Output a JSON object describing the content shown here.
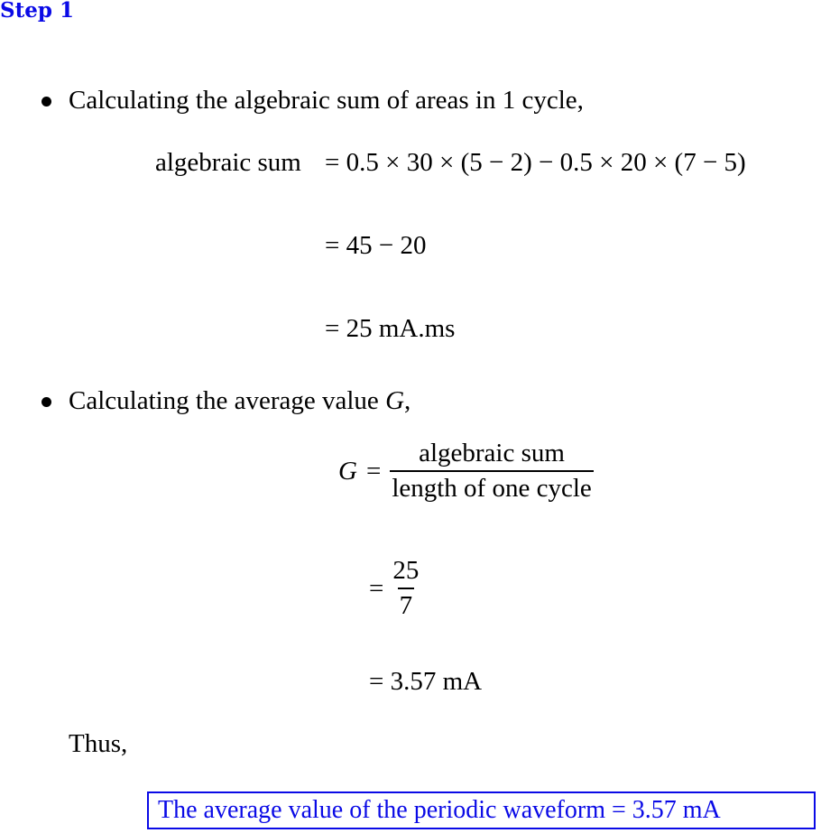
{
  "step": {
    "title": "Step 1"
  },
  "bullets": [
    {
      "text": "Calculating the algebraic sum of areas in 1 cycle,"
    },
    {
      "text_prefix": "Calculating the average value ",
      "variable": "G",
      "text_suffix": ","
    }
  ],
  "sum_equations": {
    "lhs": "algebraic sum",
    "line1": "= 0.5 × 30 × (5 − 2) − 0.5 × 20 × (7 − 5)",
    "line2": "= 45 − 20",
    "line3": "= 25 mA.ms"
  },
  "average_equations": {
    "lhs": "G",
    "equals": "=",
    "fraction1": {
      "numerator": "algebraic sum",
      "denominator": "length of one cycle"
    },
    "fraction2": {
      "numerator": "25",
      "denominator": "7"
    },
    "result": "= 3.57 mA"
  },
  "conclusion": {
    "lead": "Thus,",
    "answer": "The average value of the periodic waveform = 3.57 mA"
  },
  "colors": {
    "accent": "#0a0ae6",
    "text": "#000000"
  }
}
